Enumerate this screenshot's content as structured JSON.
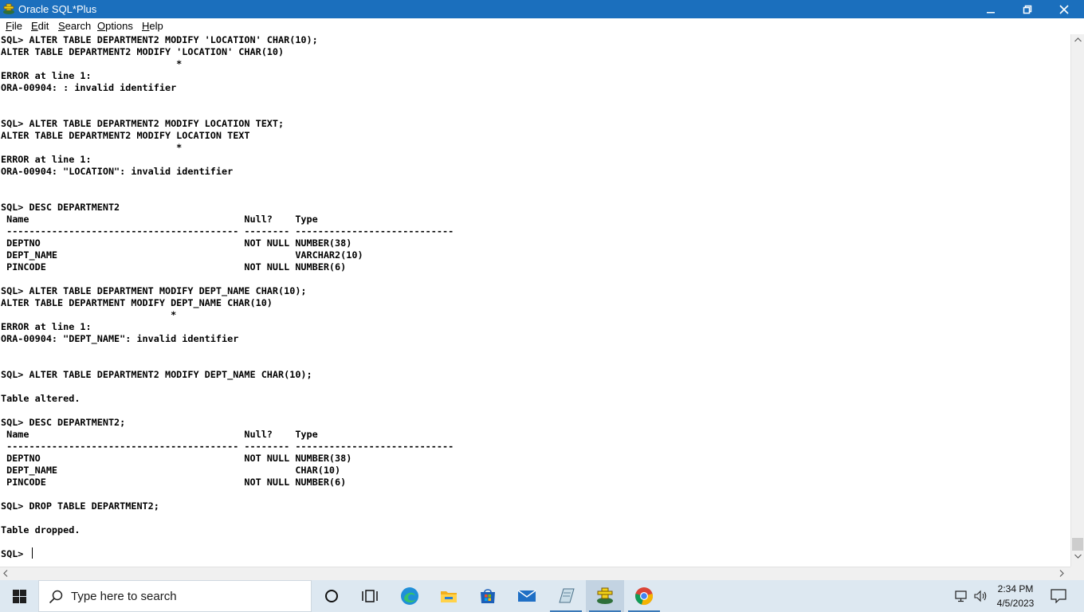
{
  "window": {
    "title": "Oracle SQL*Plus"
  },
  "menu": [
    "File",
    "Edit",
    "Search",
    "Options",
    "Help"
  ],
  "console_lines": [
    "SQL> ALTER TABLE DEPARTMENT2 MODIFY 'LOCATION' CHAR(10);",
    "ALTER TABLE DEPARTMENT2 MODIFY 'LOCATION' CHAR(10)",
    "                               *",
    "ERROR at line 1:",
    "ORA-00904: : invalid identifier",
    "",
    "",
    "SQL> ALTER TABLE DEPARTMENT2 MODIFY LOCATION TEXT;",
    "ALTER TABLE DEPARTMENT2 MODIFY LOCATION TEXT",
    "                               *",
    "ERROR at line 1:",
    "ORA-00904: \"LOCATION\": invalid identifier",
    "",
    "",
    "SQL> DESC DEPARTMENT2",
    " Name                                      Null?    Type",
    " ----------------------------------------- -------- ----------------------------",
    " DEPTNO                                    NOT NULL NUMBER(38)",
    " DEPT_NAME                                          VARCHAR2(10)",
    " PINCODE                                   NOT NULL NUMBER(6)",
    "",
    "SQL> ALTER TABLE DEPARTMENT MODIFY DEPT_NAME CHAR(10);",
    "ALTER TABLE DEPARTMENT MODIFY DEPT_NAME CHAR(10)",
    "                              *",
    "ERROR at line 1:",
    "ORA-00904: \"DEPT_NAME\": invalid identifier",
    "",
    "",
    "SQL> ALTER TABLE DEPARTMENT2 MODIFY DEPT_NAME CHAR(10);",
    "",
    "Table altered.",
    "",
    "SQL> DESC DEPARTMENT2;",
    " Name                                      Null?    Type",
    " ----------------------------------------- -------- ----------------------------",
    " DEPTNO                                    NOT NULL NUMBER(38)",
    " DEPT_NAME                                          CHAR(10)",
    " PINCODE                                   NOT NULL NUMBER(6)",
    "",
    "SQL> DROP TABLE DEPARTMENT2;",
    "",
    "Table dropped.",
    "",
    "SQL> "
  ],
  "taskbar": {
    "search_placeholder": "Type here to search",
    "apps": [
      "cortana-icon",
      "task-view-icon",
      "edge-icon",
      "file-explorer-icon",
      "store-icon",
      "mail-icon",
      "notepad-icon",
      "sqlplus-icon",
      "chrome-icon"
    ],
    "active_app": "sqlplus-icon"
  },
  "clock": {
    "time": "2:34 PM",
    "date": "4/5/2023"
  },
  "colors": {
    "titlebar": "#1b6fbd",
    "taskbar": "#dde8f1"
  }
}
